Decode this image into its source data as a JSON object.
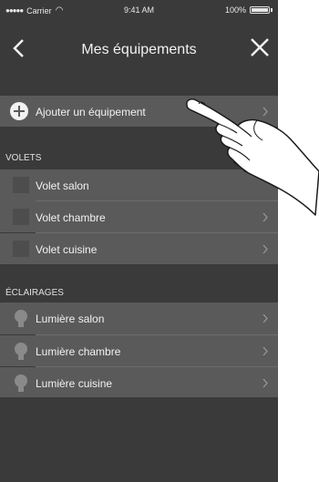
{
  "status_bar": {
    "carrier": "Carrier",
    "time": "9:41 AM",
    "battery": "100%",
    "battery_level": 1.0
  },
  "navbar": {
    "title": "Mes équipements"
  },
  "add_row": {
    "label": "Ajouter un équipement"
  },
  "sections": [
    {
      "title": "VOLETS",
      "items": [
        {
          "label": "Volet salon"
        },
        {
          "label": "Volet chambre"
        },
        {
          "label": "Volet cuisine"
        }
      ]
    },
    {
      "title": "ÉCLAIRAGES",
      "items": [
        {
          "label": "Lumière salon"
        },
        {
          "label": "Lumière chambre"
        },
        {
          "label": "Lumière cuisine"
        }
      ]
    }
  ],
  "colors": {
    "background": "#3a3a3a",
    "row": "#5a5a5a",
    "text": "#f2f2f2",
    "icon": "#8a8a8a"
  },
  "icons": {
    "back": "chevron-left-icon",
    "close": "close-icon",
    "add": "plus-circle-icon",
    "shutter": "square-icon",
    "light": "bulb-icon",
    "chevron": "chevron-right-icon",
    "cursor": "pointing-hand-icon"
  }
}
